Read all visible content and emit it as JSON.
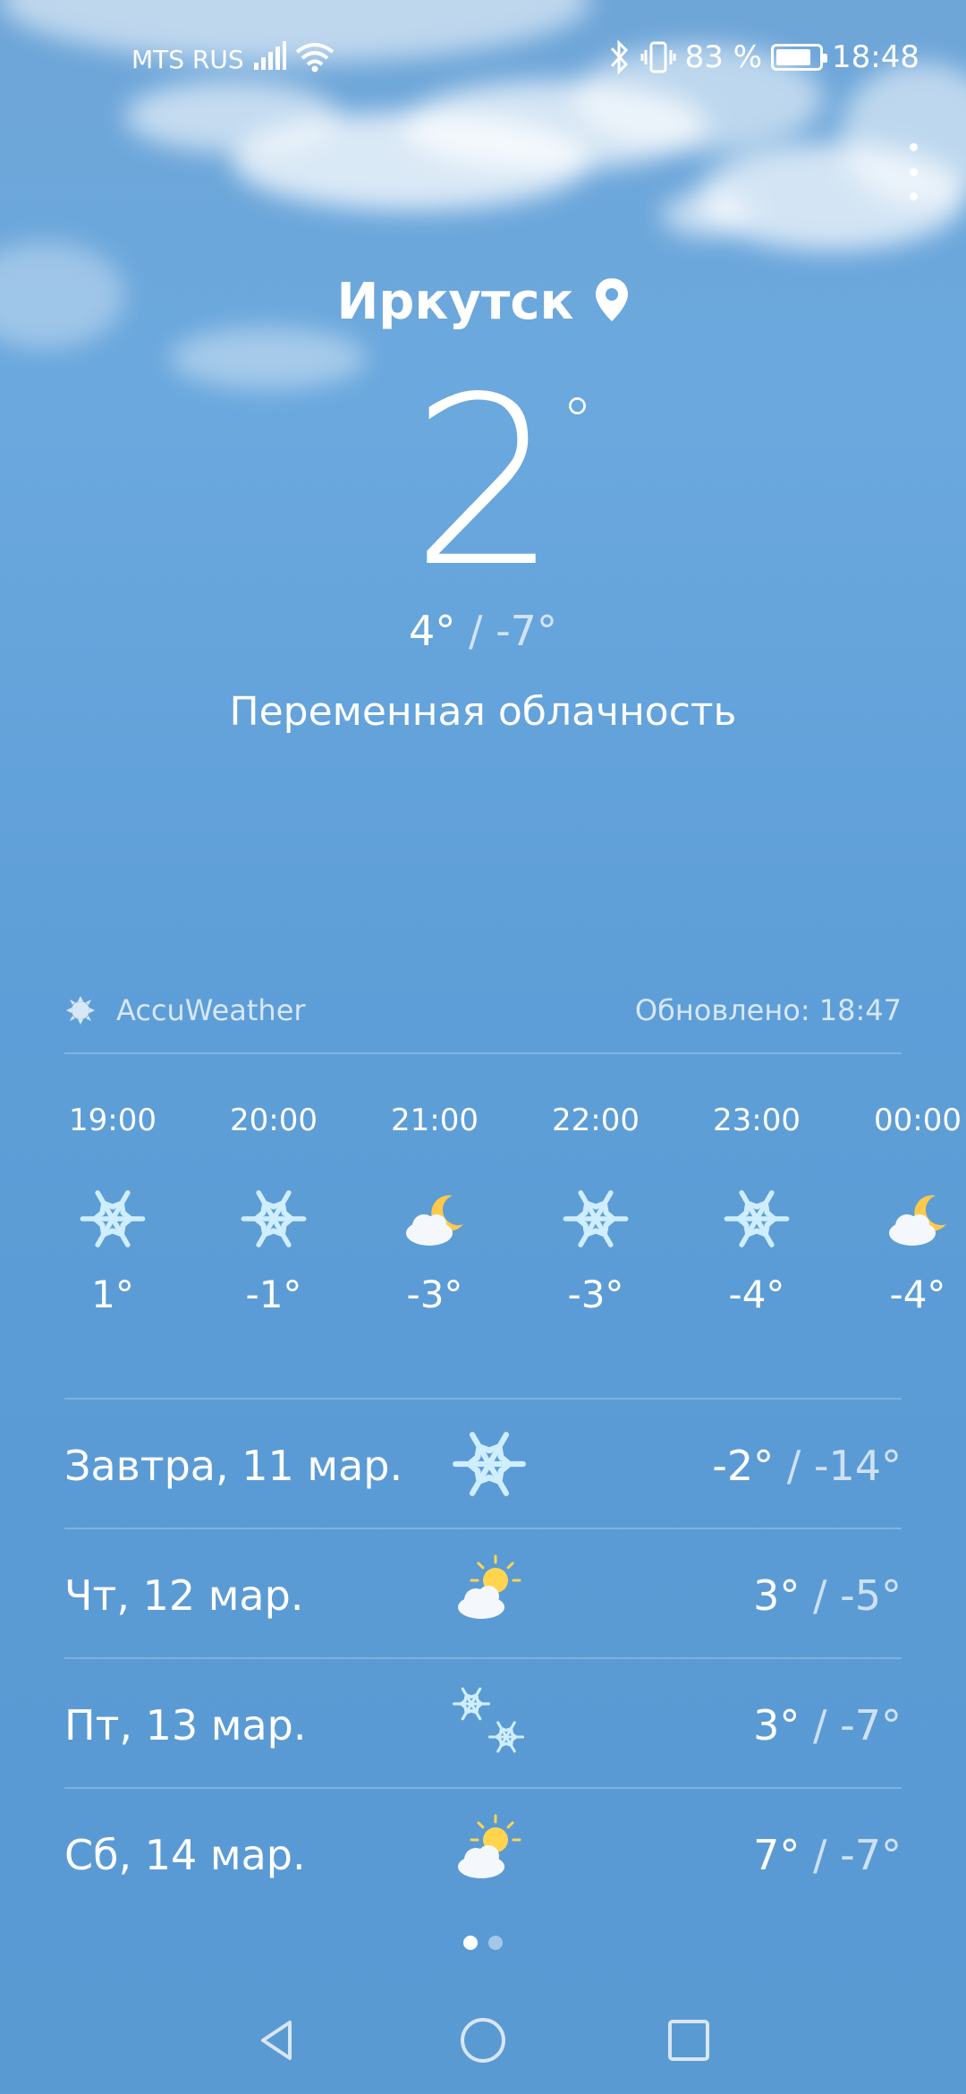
{
  "status_bar": {
    "carrier": "MTS RUS",
    "battery_text": "83 %",
    "battery_level": 0.83,
    "time": "18:48"
  },
  "location": {
    "city": "Иркутск"
  },
  "current": {
    "temp": "2",
    "deg": "°",
    "high": "4°",
    "sep": "/",
    "low": "-7°",
    "condition": "Переменная облачность"
  },
  "provider": {
    "name": "AccuWeather",
    "updated": "Обновлено: 18:47"
  },
  "hourly": [
    {
      "time": "19:00",
      "icon": "snow-icon",
      "temp": "1°"
    },
    {
      "time": "20:00",
      "icon": "snow-icon",
      "temp": "-1°"
    },
    {
      "time": "21:00",
      "icon": "moon-cloud-icon",
      "temp": "-3°"
    },
    {
      "time": "22:00",
      "icon": "snow-icon",
      "temp": "-3°"
    },
    {
      "time": "23:00",
      "icon": "snow-icon",
      "temp": "-4°"
    },
    {
      "time": "00:00",
      "icon": "moon-cloud-icon",
      "temp": "-4°"
    }
  ],
  "daily": [
    {
      "name": "Завтра, 11 мар.",
      "icon": "snow-icon",
      "high": "-2°",
      "sep": "/",
      "low": "-14°"
    },
    {
      "name": "Чт, 12 мар.",
      "icon": "sun-cloud-icon",
      "high": "3°",
      "sep": "/",
      "low": "-5°"
    },
    {
      "name": "Пт, 13 мар.",
      "icon": "flurries-icon",
      "high": "3°",
      "sep": "/",
      "low": "-7°"
    },
    {
      "name": "Сб, 14 мар.",
      "icon": "sun-cloud-icon",
      "high": "7°",
      "sep": "/",
      "low": "-7°"
    }
  ],
  "pager": {
    "pages": 2,
    "current": 1
  },
  "colors": {
    "sky_top": "#6fa6d8",
    "sky_bottom": "#5a9ad3",
    "snow_icon": "#cfeeff",
    "sun": "#ffd54f"
  }
}
